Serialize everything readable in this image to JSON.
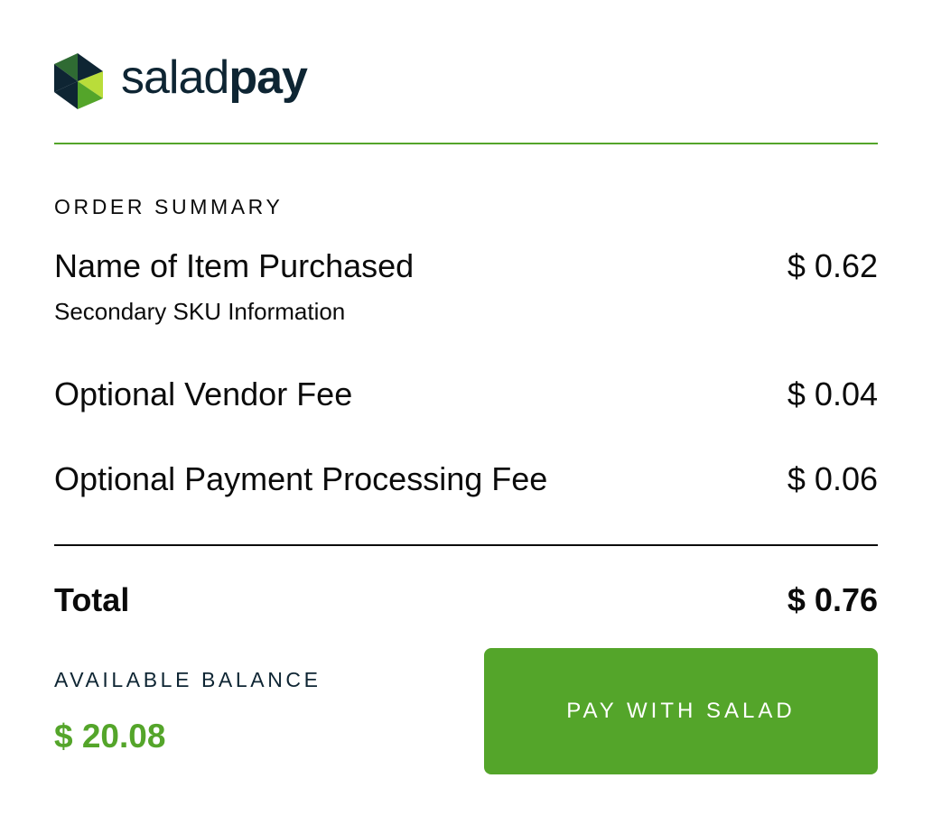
{
  "brand": {
    "logo_icon": "saladpay-logo-icon",
    "wordmark_light": "salad",
    "wordmark_bold": "pay",
    "accent_color": "#54a52a",
    "dark_color": "#0e2533"
  },
  "order_summary": {
    "title": "ORDER SUMMARY",
    "item": {
      "name": "Name of Item Purchased",
      "sku": "Secondary SKU Information",
      "amount": "$ 0.62"
    },
    "vendor_fee": {
      "label": "Optional Vendor Fee",
      "amount": "$ 0.04"
    },
    "processing_fee": {
      "label": "Optional Payment Processing Fee",
      "amount": "$ 0.06"
    },
    "total": {
      "label": "Total",
      "amount": "$ 0.76"
    }
  },
  "balance": {
    "label": "AVAILABLE BALANCE",
    "value": "$ 20.08"
  },
  "actions": {
    "pay_label": "PAY WITH SALAD"
  }
}
